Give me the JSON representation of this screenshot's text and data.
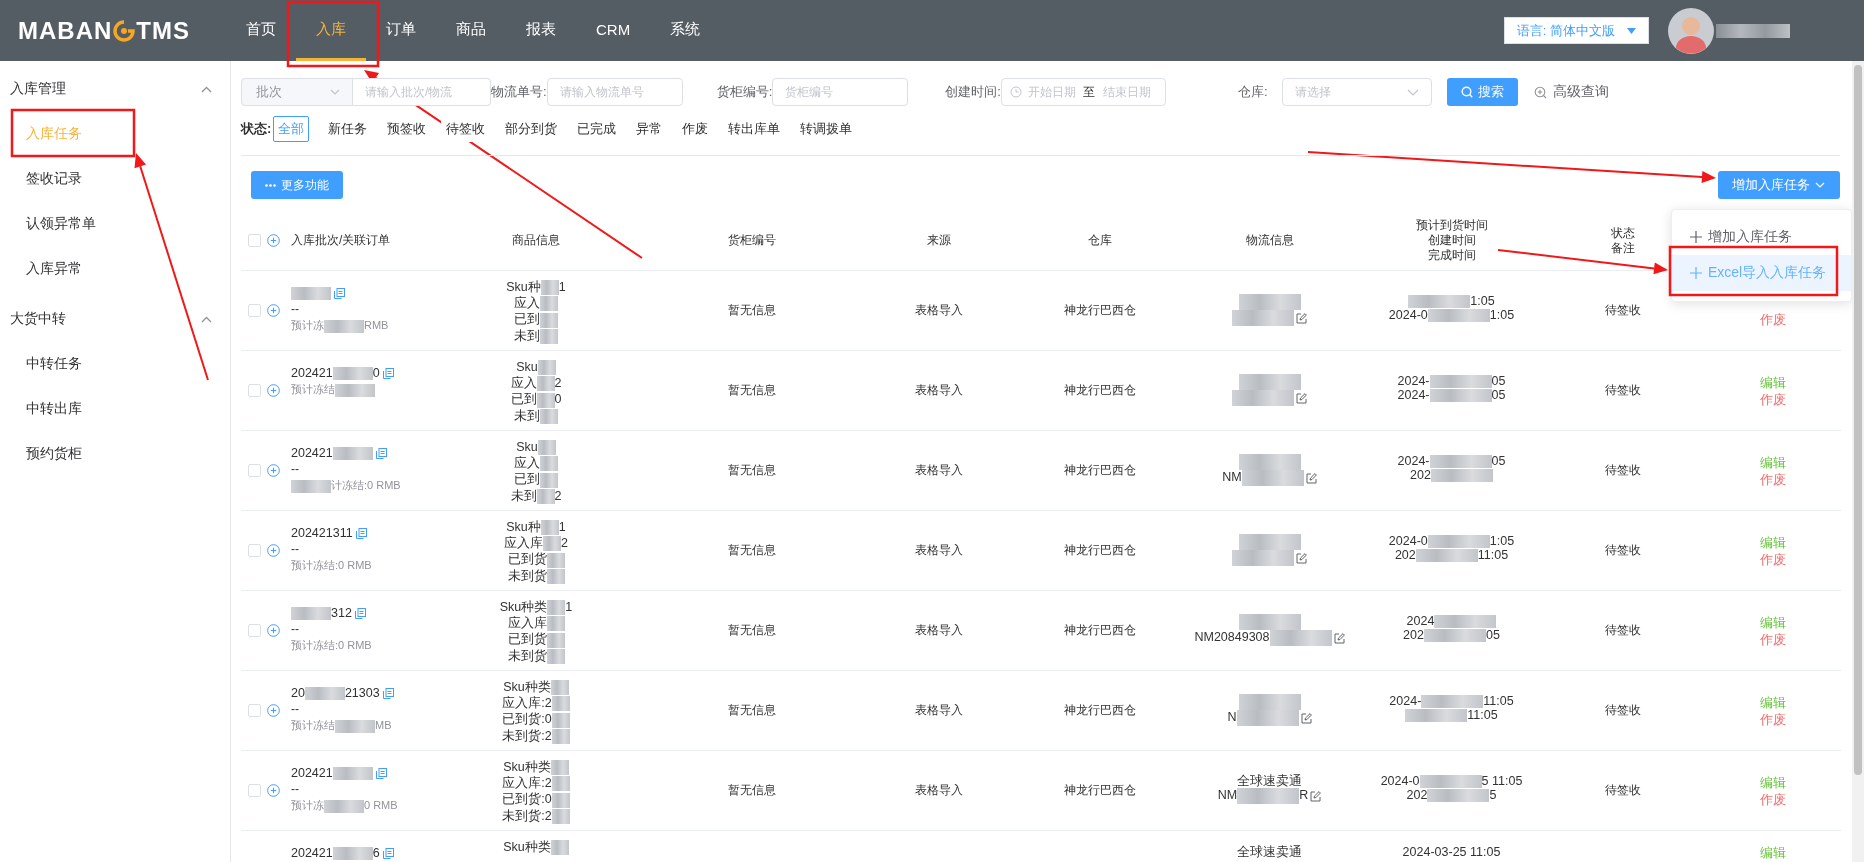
{
  "header": {
    "logo": {
      "left": "MABAN",
      "right": "TMS"
    },
    "nav": [
      {
        "label": "首页",
        "selected": false
      },
      {
        "label": "入库",
        "selected": true
      },
      {
        "label": "订单",
        "selected": false
      },
      {
        "label": "商品",
        "selected": false
      },
      {
        "label": "报表",
        "selected": false
      },
      {
        "label": "CRM",
        "selected": false
      },
      {
        "label": "系统",
        "selected": false
      }
    ],
    "language_button": "语言: 简体中文版"
  },
  "sidebar": {
    "groups": [
      {
        "title": "入库管理",
        "expanded": true,
        "items": [
          {
            "label": "入库任务",
            "selected": true
          },
          {
            "label": "签收记录",
            "selected": false
          },
          {
            "label": "认领异常单",
            "selected": false
          },
          {
            "label": "入库异常",
            "selected": false
          }
        ]
      },
      {
        "title": "大货中转",
        "expanded": true,
        "items": [
          {
            "label": "中转任务",
            "selected": false
          },
          {
            "label": "中转出库",
            "selected": false
          },
          {
            "label": "预约货柜",
            "selected": false
          }
        ]
      }
    ]
  },
  "filters": {
    "batch_select": {
      "value": "批次"
    },
    "batch_input": {
      "placeholder": "请输入批次/物流"
    },
    "fields": [
      {
        "label": "物流单号:",
        "placeholder": "请输入物流单号"
      },
      {
        "label": "货柜编号:",
        "placeholder": "货柜编号"
      }
    ],
    "created_time": {
      "label": "创建时间:",
      "start_placeholder": "开始日期",
      "separator": "至",
      "end_placeholder": "结束日期"
    },
    "warehouse": {
      "label": "仓库:",
      "placeholder": "请选择"
    },
    "search_button": "搜索",
    "advanced_search": "高级查询"
  },
  "status_filter": {
    "label": "状态:",
    "options": [
      {
        "label": "全部",
        "selected": true
      },
      {
        "label": "新任务",
        "selected": false
      },
      {
        "label": "预签收",
        "selected": false
      },
      {
        "label": "待签收",
        "selected": false
      },
      {
        "label": "部分到货",
        "selected": false
      },
      {
        "label": "已完成",
        "selected": false
      },
      {
        "label": "异常",
        "selected": false
      },
      {
        "label": "作废",
        "selected": false
      },
      {
        "label": "转出库单",
        "selected": false
      },
      {
        "label": "转调拨单",
        "selected": false
      }
    ]
  },
  "toolbar": {
    "more_button": "更多功能",
    "add_button": "增加入库任务",
    "add_menu": [
      {
        "label": "增加入库任务",
        "highlighted": false
      },
      {
        "label": "Excel导入入库任务",
        "highlighted": true
      }
    ]
  },
  "table": {
    "header_checked": false,
    "columns": [
      {
        "lines": [
          "入库批次/关联订单"
        ]
      },
      {
        "lines": [
          "商品信息"
        ]
      },
      {
        "lines": [
          "货柜编号"
        ]
      },
      {
        "lines": [
          "来源"
        ]
      },
      {
        "lines": [
          "仓库"
        ]
      },
      {
        "lines": [
          "物流信息"
        ]
      },
      {
        "lines": [
          "预计到货时间",
          "创建时间",
          "完成时间"
        ]
      },
      {
        "lines": [
          "状态",
          "备注"
        ]
      }
    ],
    "rows": [
      {
        "checked": false,
        "batch": {
          "blurred": true
        },
        "order": "--",
        "freeze": {
          "text": "预计冻",
          "blurred": true,
          "after": "RMB"
        },
        "goods": [
          {
            "text": "Sku种",
            "blurred": true,
            "after": "1"
          },
          {
            "text": "应入",
            "blurred": true
          },
          {
            "text": "已到",
            "blurred": true
          },
          {
            "text": "未到",
            "blurred": true
          }
        ],
        "container": "暂无信息",
        "source": "表格导入",
        "warehouse": "神龙行巴西仓",
        "logistics": [
          {
            "blurred": true
          },
          {
            "blurred": true
          }
        ],
        "times": [
          {
            "blurred": true,
            "after": "1:05"
          },
          {
            "text": "2024-0",
            "blurred": true,
            "after": "1:05"
          }
        ],
        "status": "待签收",
        "actions": [
          {
            "label": "作废",
            "kind": "void"
          }
        ]
      },
      {
        "checked": false,
        "batch": {
          "text": "202421",
          "blurred": true,
          "after": "0"
        },
        "freeze": {
          "text": "预计冻结",
          "blurred": true
        },
        "goods": [
          {
            "text": "Sku",
            "blurred": true
          },
          {
            "text": "应入",
            "blurred": true,
            "after": "2"
          },
          {
            "text": "已到",
            "blurred": true,
            "after": "0"
          },
          {
            "text": "未到",
            "blurred": true
          }
        ],
        "container": "暂无信息",
        "source": "表格导入",
        "warehouse": "神龙行巴西仓",
        "logistics": [
          {
            "blurred": true
          },
          {
            "blurred": true
          }
        ],
        "times": [
          {
            "text": "2024-",
            "blurred": true,
            "after": "05"
          },
          {
            "text": "2024-",
            "blurred": true,
            "after": "05"
          }
        ],
        "status": "待签收",
        "actions": [
          {
            "label": "编辑",
            "kind": "edit"
          },
          {
            "label": "作废",
            "kind": "void"
          }
        ]
      },
      {
        "checked": false,
        "batch": {
          "text": "202421",
          "blurred": true
        },
        "order": "--",
        "freeze": {
          "blurred": true,
          "after": "计冻结:0 RMB"
        },
        "goods": [
          {
            "text": "Sku",
            "blurred": true
          },
          {
            "text": "应入",
            "blurred": true
          },
          {
            "text": "已到",
            "blurred": true
          },
          {
            "text": "未到",
            "blurred": true,
            "after": "2"
          }
        ],
        "container": "暂无信息",
        "source": "表格导入",
        "warehouse": "神龙行巴西仓",
        "logistics": [
          {
            "blurred": true
          },
          {
            "text": "NM",
            "blurred": true
          }
        ],
        "times": [
          {
            "text": "2024-",
            "blurred": true,
            "after": "05"
          },
          {
            "text": "202",
            "blurred": true
          }
        ],
        "status": "待签收",
        "actions": [
          {
            "label": "编辑",
            "kind": "edit"
          },
          {
            "label": "作废",
            "kind": "void"
          }
        ]
      },
      {
        "checked": false,
        "batch": {
          "text": "202421311",
          "blurred": false
        },
        "order": "--",
        "freeze": {
          "text": "预计冻结:0 RMB",
          "blurred": false
        },
        "goods": [
          {
            "text": "Sku种",
            "blurred": true,
            "after": "1"
          },
          {
            "text": "应入库",
            "blurred": true,
            "after": "2"
          },
          {
            "text": "已到货",
            "blurred": true
          },
          {
            "text": "未到货",
            "blurred": true
          }
        ],
        "container": "暂无信息",
        "source": "表格导入",
        "warehouse": "神龙行巴西仓",
        "logistics": [
          {
            "blurred": true
          },
          {
            "blurred": true
          }
        ],
        "times": [
          {
            "text": "2024-0",
            "blurred": true,
            "after": "1:05"
          },
          {
            "text": "202",
            "blurred": true,
            "after": "11:05"
          }
        ],
        "status": "待签收",
        "actions": [
          {
            "label": "编辑",
            "kind": "edit"
          },
          {
            "label": "作废",
            "kind": "void"
          }
        ]
      },
      {
        "checked": false,
        "batch": {
          "blurred": true,
          "after": "312"
        },
        "order": "--",
        "freeze": {
          "text": "预计冻结:0 RMB",
          "blurred": false
        },
        "goods": [
          {
            "text": "Sku种类",
            "blurred": true,
            "after": "1"
          },
          {
            "text": "应入库",
            "blurred": true
          },
          {
            "text": "已到货",
            "blurred": true
          },
          {
            "text": "未到货",
            "blurred": true
          }
        ],
        "container": "暂无信息",
        "source": "表格导入",
        "warehouse": "神龙行巴西仓",
        "logistics": [
          {
            "blurred": true
          },
          {
            "text": "NM20849308",
            "blurred": true
          }
        ],
        "times": [
          {
            "text": "2024",
            "blurred": true
          },
          {
            "text": "202",
            "blurred": true,
            "after": "05"
          }
        ],
        "status": "待签收",
        "actions": [
          {
            "label": "编辑",
            "kind": "edit"
          },
          {
            "label": "作废",
            "kind": "void"
          }
        ]
      },
      {
        "checked": false,
        "batch": {
          "text": "20",
          "blurred": true,
          "after": "21303"
        },
        "order": "--",
        "freeze": {
          "text": "预计冻结",
          "blurred": true,
          "after": "MB"
        },
        "goods": [
          {
            "text": "Sku种类",
            "blurred": true
          },
          {
            "text": "应入库:2",
            "blurred": true
          },
          {
            "text": "已到货:0",
            "blurred": true
          },
          {
            "text": "未到货:2",
            "blurred": true
          }
        ],
        "container": "暂无信息",
        "source": "表格导入",
        "warehouse": "神龙行巴西仓",
        "logistics": [
          {
            "blurred": true
          },
          {
            "text": "N",
            "blurred": true
          }
        ],
        "times": [
          {
            "text": "2024-",
            "blurred": true,
            "after": "11:05"
          },
          {
            "blurred": true,
            "after": "11:05"
          }
        ],
        "status": "待签收",
        "actions": [
          {
            "label": "编辑",
            "kind": "edit"
          },
          {
            "label": "作废",
            "kind": "void"
          }
        ]
      },
      {
        "checked": false,
        "batch": {
          "text": "202421",
          "blurred": true
        },
        "order": "--",
        "freeze": {
          "text": "预计冻",
          "blurred": true,
          "after": "0 RMB"
        },
        "goods": [
          {
            "text": "Sku种类",
            "blurred": true
          },
          {
            "text": "应入库:2",
            "blurred": true
          },
          {
            "text": "已到货:0",
            "blurred": true
          },
          {
            "text": "未到货:2",
            "blurred": true
          }
        ],
        "container": "暂无信息",
        "source": "表格导入",
        "warehouse": "神龙行巴西仓",
        "logistics": [
          {
            "text": "全球速卖通",
            "blurred": false
          },
          {
            "text": "NM",
            "blurred": true,
            "after": "R"
          }
        ],
        "times": [
          {
            "text": "2024-0",
            "blurred": true,
            "after": "5 11:05"
          },
          {
            "text": "202",
            "blurred": true,
            "after": "5"
          }
        ],
        "status": "待签收",
        "actions": [
          {
            "label": "编辑",
            "kind": "edit"
          },
          {
            "label": "作废",
            "kind": "void"
          }
        ]
      },
      {
        "batch": {
          "text": "202421",
          "blurred": true,
          "after": "6"
        },
        "goods": [
          {
            "text": "Sku种类",
            "blurred": true
          }
        ],
        "logistics": [
          {
            "text": "全球速卖通",
            "blurred": false
          }
        ],
        "times": [
          {
            "text": "2024-03-25 11:05",
            "blurred": false
          }
        ],
        "actions": [
          {
            "label": "编辑",
            "kind": "edit"
          }
        ]
      }
    ]
  }
}
